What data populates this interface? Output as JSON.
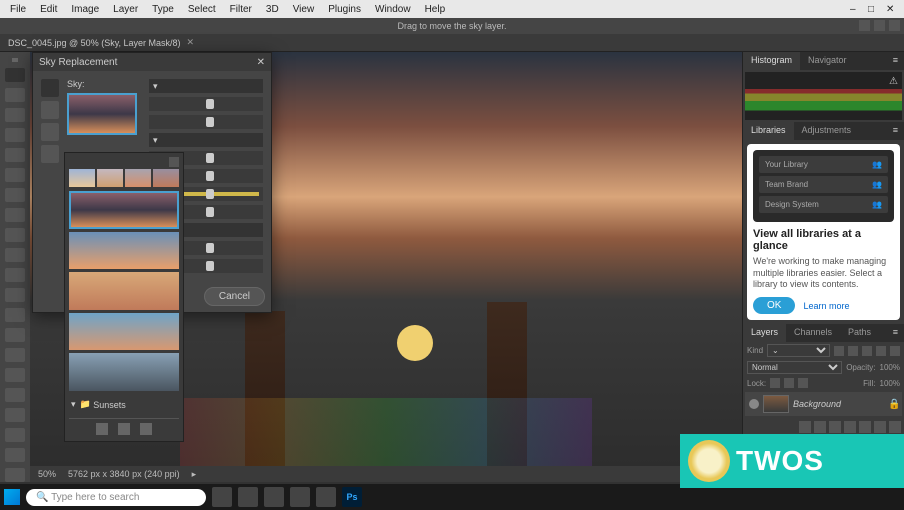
{
  "menus": [
    "File",
    "Edit",
    "Image",
    "Layer",
    "Type",
    "Select",
    "Filter",
    "3D",
    "View",
    "Plugins",
    "Window",
    "Help"
  ],
  "hint": "Drag to move the sky layer.",
  "document_tab": "DSC_0045.jpg @ 50% (Sky, Layer Mask/8)",
  "status": {
    "zoom": "50%",
    "info": "5762 px x 3840 px (240 ppi)"
  },
  "dialog": {
    "title": "Sky Replacement",
    "sky_label": "Sky:",
    "cancel": "Cancel"
  },
  "flyout": {
    "category": "Sunsets"
  },
  "right": {
    "histogram_tabs": [
      "Histogram",
      "Navigator"
    ],
    "libraries_tabs": [
      "Libraries",
      "Adjustments"
    ],
    "lib_card": {
      "rows": [
        "Your Library",
        "Team Brand",
        "Design System"
      ],
      "heading": "View all libraries at a glance",
      "body": "We're working to make managing multiple libraries easier. Select a library to view its contents.",
      "ok": "OK",
      "learn": "Learn more"
    },
    "layers_tabs": [
      "Layers",
      "Channels",
      "Paths"
    ],
    "filter_label": "Kind",
    "blend": "Normal",
    "opacity_label": "Opacity:",
    "opacity_val": "100%",
    "lock_label": "Lock:",
    "fill_label": "Fill:",
    "fill_val": "100%",
    "layer_name": "Background"
  },
  "taskbar": {
    "search": "Type here to search"
  },
  "overlay": "TWOS"
}
